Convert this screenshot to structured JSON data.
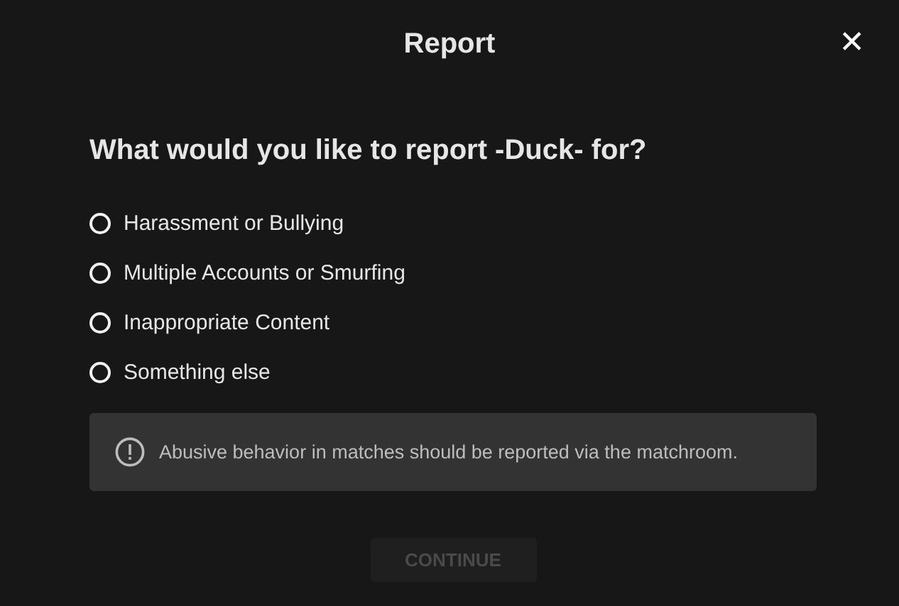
{
  "dialog": {
    "title": "Report",
    "close": "✕"
  },
  "question": "What would you like to report -Duck- for?",
  "options": [
    {
      "label": "Harassment or Bullying",
      "selected": false
    },
    {
      "label": "Multiple Accounts or Smurfing",
      "selected": false
    },
    {
      "label": "Inappropriate Content",
      "selected": false
    },
    {
      "label": "Something else",
      "selected": false
    }
  ],
  "notice": {
    "text": "Abusive behavior in matches should be reported via the matchroom."
  },
  "button": {
    "label": "CONTINUE",
    "disabled": true
  }
}
